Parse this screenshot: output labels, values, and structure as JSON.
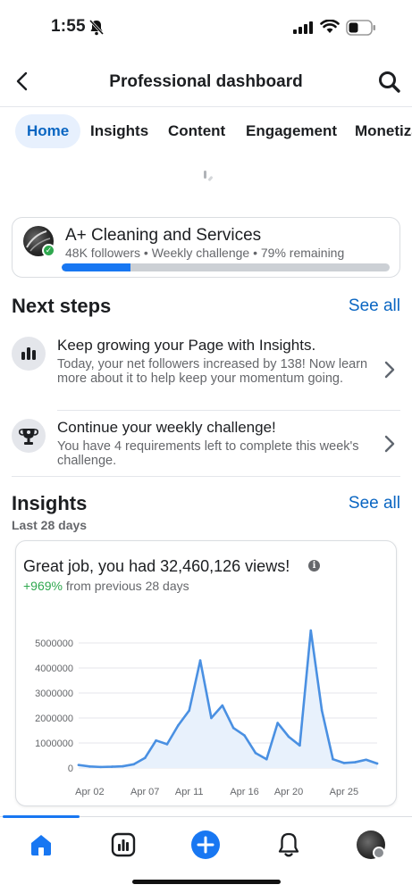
{
  "status_bar": {
    "time": "1:55"
  },
  "header": {
    "title": "Professional dashboard"
  },
  "tabs": [
    {
      "label": "Home",
      "active": true
    },
    {
      "label": "Insights",
      "active": false
    },
    {
      "label": "Content",
      "active": false
    },
    {
      "label": "Engagement",
      "active": false
    },
    {
      "label": "Monetiza",
      "active": false
    }
  ],
  "challenge_card": {
    "page_name": "A+ Cleaning and Services",
    "meta": "48K followers • Weekly challenge • 79% remaining",
    "progress_fraction": 0.21
  },
  "next_steps": {
    "title": "Next steps",
    "see_all": "See all",
    "items": [
      {
        "icon": "bar-chart-icon",
        "title": "Keep growing your Page with Insights.",
        "description": "Today, your net followers increased by 138! Now learn more about it to help keep your momentum going."
      },
      {
        "icon": "trophy-icon",
        "title": "Continue your weekly challenge!",
        "description": "You have 4 requirements left to complete this week's challenge."
      }
    ]
  },
  "insights": {
    "title": "Insights",
    "see_all": "See all",
    "subtitle": "Last 28 days",
    "headline": "Great job, you had 32,460,126 views!",
    "delta_value": "+969%",
    "delta_text": "from previous 28 days"
  },
  "chart_data": {
    "type": "area",
    "x": [
      "Apr 01",
      "Apr 02",
      "Apr 03",
      "Apr 04",
      "Apr 05",
      "Apr 06",
      "Apr 07",
      "Apr 08",
      "Apr 09",
      "Apr 10",
      "Apr 11",
      "Apr 12",
      "Apr 13",
      "Apr 14",
      "Apr 15",
      "Apr 16",
      "Apr 17",
      "Apr 18",
      "Apr 19",
      "Apr 20",
      "Apr 21",
      "Apr 22",
      "Apr 23",
      "Apr 24",
      "Apr 25",
      "Apr 26",
      "Apr 27",
      "Apr 28"
    ],
    "y": [
      120000,
      60000,
      40000,
      50000,
      70000,
      150000,
      400000,
      1100000,
      950000,
      1700000,
      2300000,
      4300000,
      2000000,
      2500000,
      1600000,
      1300000,
      600000,
      350000,
      1800000,
      1250000,
      900000,
      5500000,
      2300000,
      350000,
      200000,
      230000,
      330000,
      180000
    ],
    "x_tick_labels": [
      "Apr 02",
      "Apr 07",
      "Apr 11",
      "Apr 16",
      "Apr 20",
      "Apr 25"
    ],
    "y_tick_labels": [
      "5000000",
      "4000000",
      "3000000",
      "2000000",
      "1000000",
      "0"
    ],
    "y_ticks": [
      5000000,
      4000000,
      3000000,
      2000000,
      1000000,
      0
    ],
    "ylim": [
      0,
      5500000
    ],
    "grid": true,
    "colors": {
      "line": "#4a90e2",
      "fill": "#e8f1fc"
    }
  },
  "bottom_nav": {
    "items": [
      "home-icon",
      "insights-icon",
      "create-icon",
      "notifications-icon",
      "profile-icon"
    ],
    "active": "home-icon"
  },
  "colors": {
    "accent": "#1877f2",
    "link": "#0a66c2",
    "positive": "#2fa84f"
  }
}
